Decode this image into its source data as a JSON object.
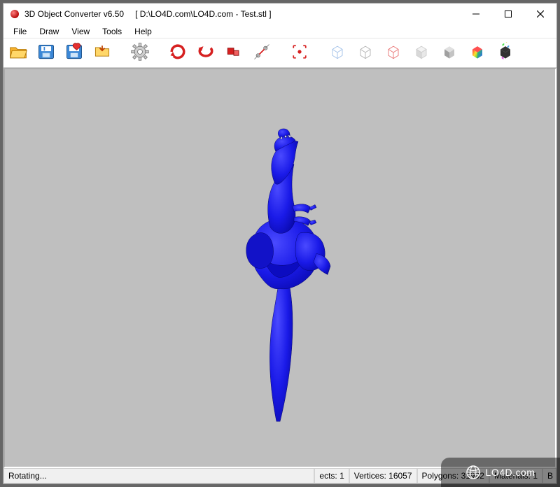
{
  "window": {
    "title": "3D Object Converter v6.50",
    "path": "[ D:\\LO4D.com\\LO4D.com - Test.stl ]"
  },
  "menu": {
    "items": [
      "File",
      "Draw",
      "View",
      "Tools",
      "Help"
    ]
  },
  "toolbar": {
    "buttons": [
      {
        "name": "open-icon"
      },
      {
        "name": "save-icon"
      },
      {
        "name": "save-favorite-icon"
      },
      {
        "name": "folder-arrow-icon"
      },
      {
        "name": "settings-gear-icon"
      },
      {
        "name": "rotate-x-icon"
      },
      {
        "name": "rotate-y-icon"
      },
      {
        "name": "rotate-z-icon"
      },
      {
        "name": "axis-icon"
      },
      {
        "name": "bounds-toggle-icon"
      },
      {
        "name": "wireframe-box-icon"
      },
      {
        "name": "wireframe-box-alt-icon"
      },
      {
        "name": "wireframe-box-red-icon"
      },
      {
        "name": "solid-box-icon"
      },
      {
        "name": "shaded-box-icon"
      },
      {
        "name": "color-box-icon"
      },
      {
        "name": "checker-box-icon"
      }
    ]
  },
  "status": {
    "left": "Rotating...",
    "objects_label": "ects:",
    "objects": "1",
    "vertices_label": "Vertices:",
    "vertices": "16057",
    "polygons_label": "Polygons:",
    "polygons": "31902",
    "materials_label": "Materials:",
    "materials": "1",
    "tail": "B"
  },
  "watermark": {
    "text": "LO4D.com"
  },
  "viewport": {
    "model_color": "#1a1aE8"
  }
}
